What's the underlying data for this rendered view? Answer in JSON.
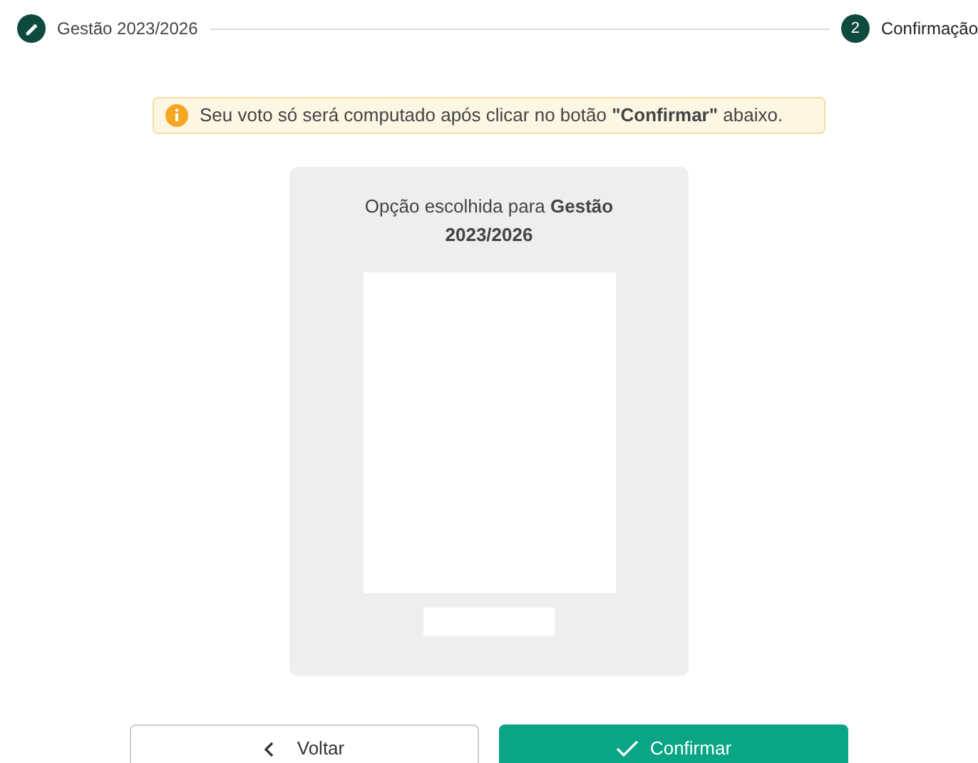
{
  "stepper": [
    {
      "label": "Gestão 2023/2026",
      "kind": "done"
    },
    {
      "label": "Confirmação",
      "kind": "current",
      "number": "2"
    }
  ],
  "alert": {
    "text": "Seu voto só será computado após clicar no botão **\"Confirmar\"** abaixo."
  },
  "ballot": {
    "title": "Opção escolhida para **Gestão 2023/2026**"
  },
  "buttons": [
    {
      "label": "Voltar",
      "kind": "back"
    },
    {
      "label": "Confirmar",
      "kind": "confirm"
    }
  ]
}
